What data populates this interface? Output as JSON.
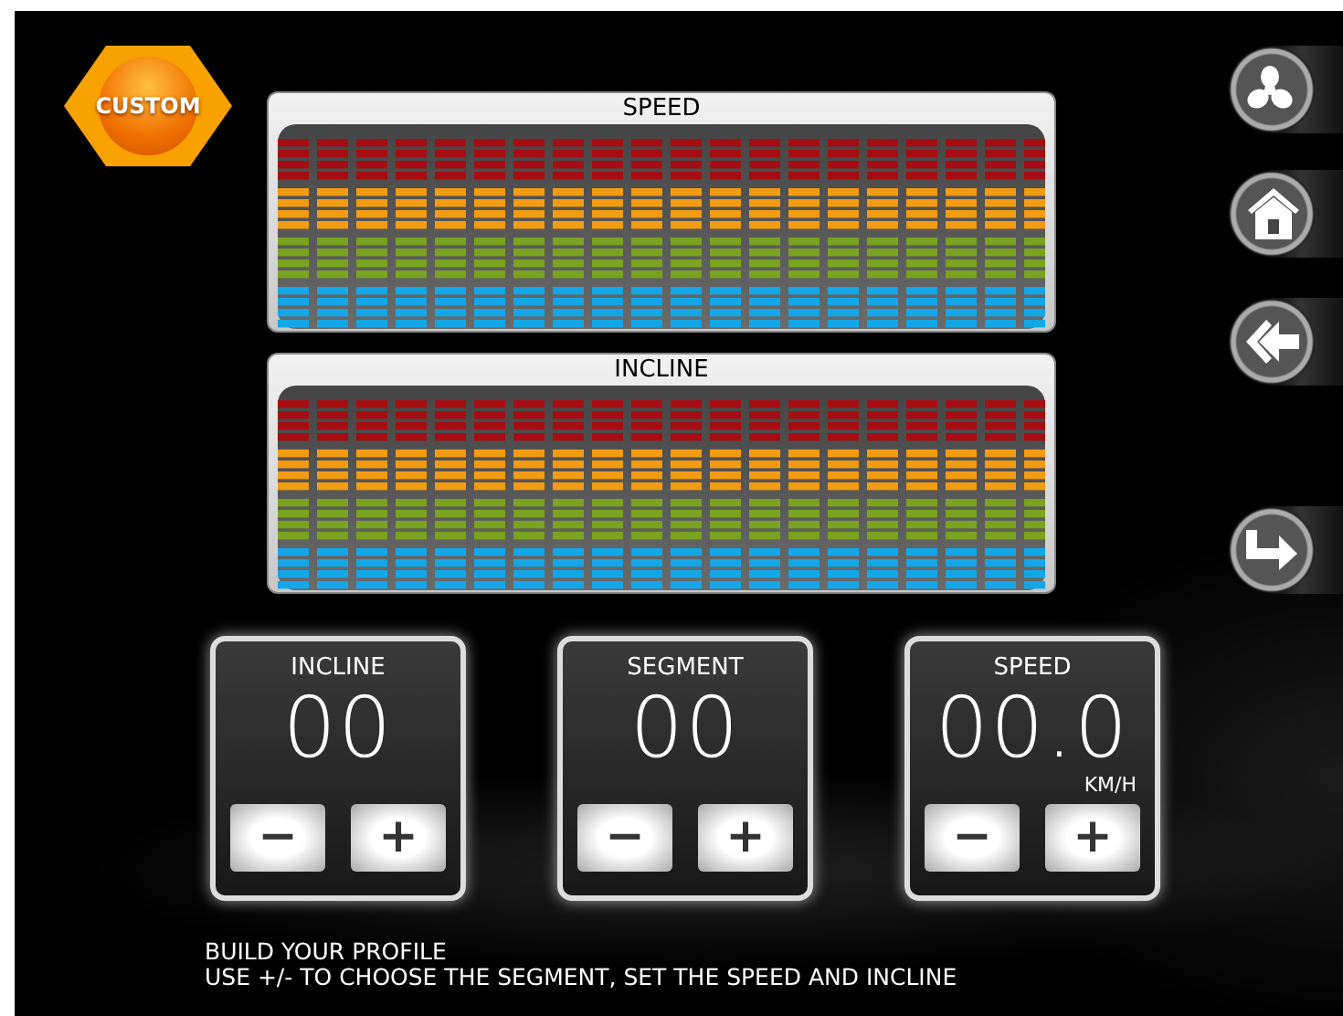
{
  "badge": {
    "label": "CUSTOM"
  },
  "profiles": [
    {
      "title": "SPEED"
    },
    {
      "title": "INCLINE"
    }
  ],
  "side_buttons": [
    {
      "kind": "fan"
    },
    {
      "kind": "home"
    },
    {
      "kind": "back"
    },
    {
      "kind": "exit"
    }
  ],
  "controls": [
    {
      "label": "INCLINE",
      "value": "00",
      "minus": "−",
      "plus": "+"
    },
    {
      "label": "SEGMENT",
      "value": "00",
      "minus": "−",
      "plus": "+"
    },
    {
      "label": "SPEED",
      "value": "00.0",
      "unit": "KM/H",
      "minus": "−",
      "plus": "+"
    }
  ],
  "instructions": [
    "BUILD YOUR PROFILE",
    "USE +/- TO CHOOSE THE SEGMENT, SET THE SPEED AND INCLINE"
  ]
}
